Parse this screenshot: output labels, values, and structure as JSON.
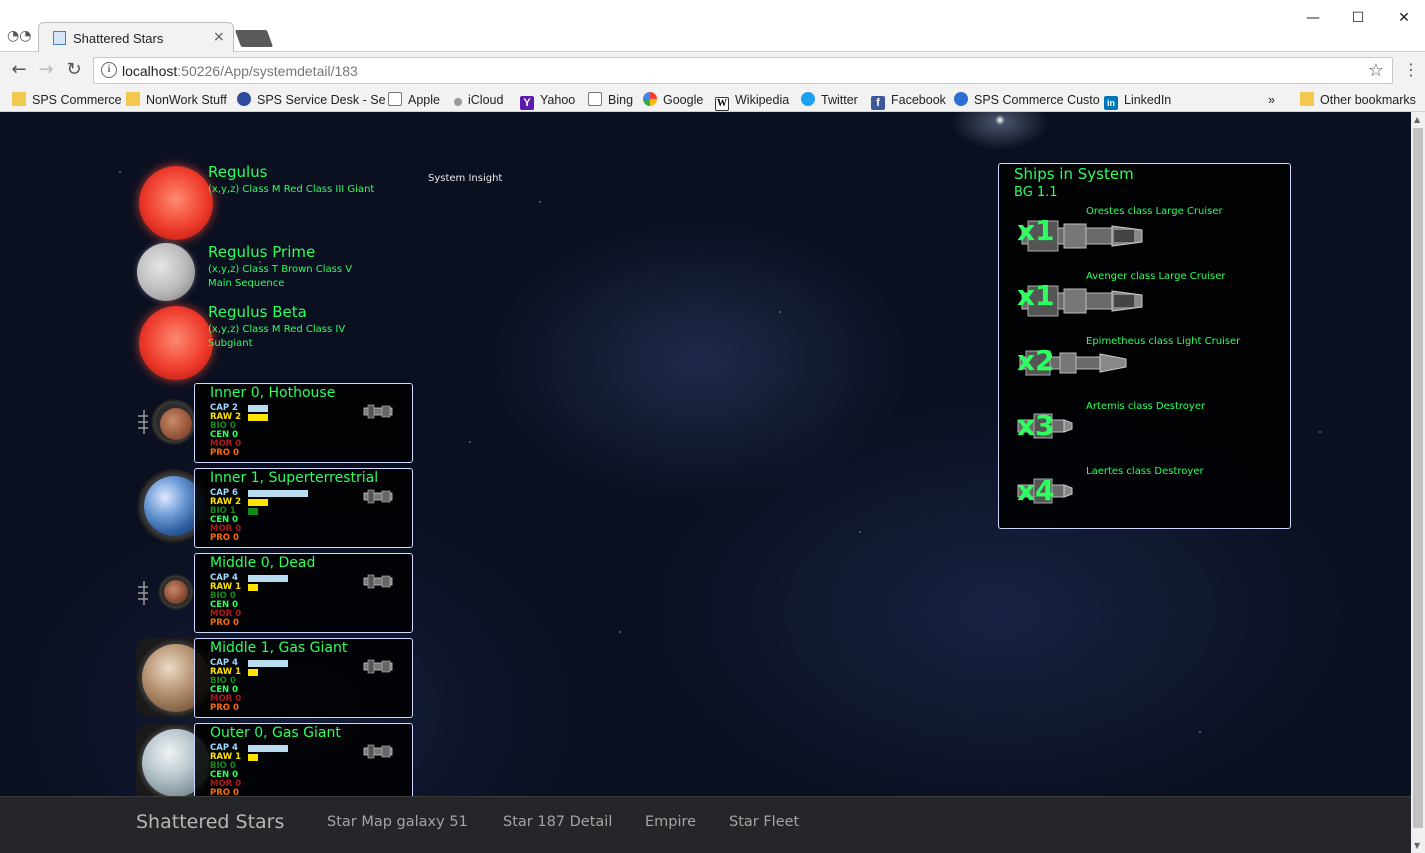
{
  "browser": {
    "tab_title": "Shattered Stars",
    "url_host": "localhost",
    "url_rest": ":50226/App/systemdetail/183",
    "bookmarks": [
      {
        "label": "SPS Commerce",
        "icon": "folder-icon"
      },
      {
        "label": "NonWork Stuff",
        "icon": "folder-icon"
      },
      {
        "label": "SPS Service Desk - Se",
        "icon": "gear-icon"
      },
      {
        "label": "Apple",
        "icon": "doc-icon"
      },
      {
        "label": "iCloud",
        "icon": "apple-icon"
      },
      {
        "label": "Yahoo",
        "icon": "yahoo-icon"
      },
      {
        "label": "Bing",
        "icon": "doc-icon"
      },
      {
        "label": "Google",
        "icon": "google-icon"
      },
      {
        "label": "Wikipedia",
        "icon": "wikipedia-icon"
      },
      {
        "label": "Twitter",
        "icon": "twitter-icon"
      },
      {
        "label": "Facebook",
        "icon": "facebook-icon"
      },
      {
        "label": "SPS Commerce Custo",
        "icon": "sps-icon"
      },
      {
        "label": "LinkedIn",
        "icon": "linkedin-icon"
      }
    ],
    "more_bookmarks": "»",
    "other_bookmarks": "Other bookmarks"
  },
  "system": {
    "insight": "System Insight",
    "stars": [
      {
        "name": "Regulus",
        "desc": "(x,y,z) Class M Red Class III Giant",
        "type": "red"
      },
      {
        "name": "Regulus Prime",
        "desc": "(x,y,z) Class T Brown Class V Main Sequence",
        "type": "brown"
      },
      {
        "name": "Regulus Beta",
        "desc": "(x,y,z) Class M Red Class IV Subgiant",
        "type": "red"
      }
    ],
    "planets": [
      {
        "name": "Inner 0, Hothouse",
        "cap": "CAP 2",
        "raw": "RAW 2",
        "bio": "BIO 0",
        "cen": "CEN 0",
        "mor": "MOR 0",
        "pro": "PRO 0",
        "cap_v": 2,
        "raw_v": 2,
        "bio_v": 0
      },
      {
        "name": "Inner 1, Superterrestrial",
        "cap": "CAP 6",
        "raw": "RAW 2",
        "bio": "BIO 1",
        "cen": "CEN 0",
        "mor": "MOR 0",
        "pro": "PRO 0",
        "cap_v": 6,
        "raw_v": 2,
        "bio_v": 1
      },
      {
        "name": "Middle 0, Dead",
        "cap": "CAP 4",
        "raw": "RAW 1",
        "bio": "BIO 0",
        "cen": "CEN 0",
        "mor": "MOR 0",
        "pro": "PRO 0",
        "cap_v": 4,
        "raw_v": 1,
        "bio_v": 0
      },
      {
        "name": "Middle 1, Gas Giant",
        "cap": "CAP 4",
        "raw": "RAW 1",
        "bio": "BIO 0",
        "cen": "CEN 0",
        "mor": "MOR 0",
        "pro": "PRO 0",
        "cap_v": 4,
        "raw_v": 1,
        "bio_v": 0
      },
      {
        "name": "Outer 0, Gas Giant",
        "cap": "CAP 4",
        "raw": "RAW 1",
        "bio": "BIO 0",
        "cen": "CEN 0",
        "mor": "MOR 0",
        "pro": "PRO 0",
        "cap_v": 4,
        "raw_v": 1,
        "bio_v": 0
      }
    ]
  },
  "ships": {
    "title": "Ships in System",
    "group": "BG 1.1",
    "entries": [
      {
        "qty": "x1",
        "label": "Orestes class Large Cruiser"
      },
      {
        "qty": "x1",
        "label": "Avenger class Large Cruiser"
      },
      {
        "qty": "x2",
        "label": "Epimetheus class Light Cruiser"
      },
      {
        "qty": "x3",
        "label": "Artemis class Destroyer"
      },
      {
        "qty": "x4",
        "label": "Laertes class Destroyer"
      }
    ]
  },
  "footer": {
    "brand": "Shattered Stars",
    "links": [
      "Star Map galaxy 51",
      "Star 187 Detail",
      "Empire",
      "Star Fleet"
    ]
  },
  "colors": {
    "accent": "#2cff5e",
    "cap": "#b9dcf1",
    "raw": "#ffe300",
    "bio": "#128a1a"
  }
}
